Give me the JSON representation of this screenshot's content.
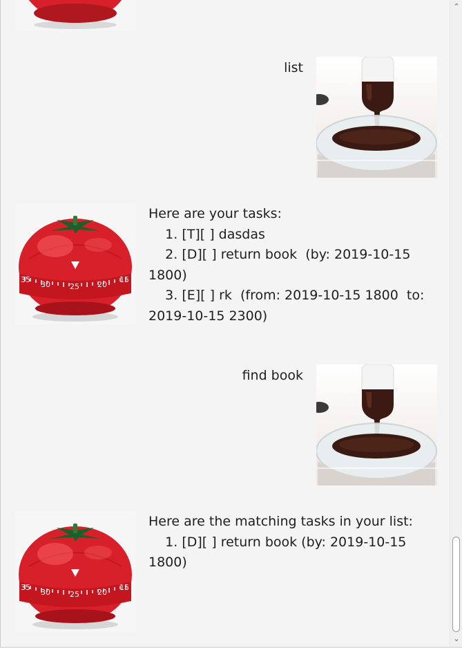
{
  "conversation": {
    "user_messages": [
      {
        "text": "list"
      },
      {
        "text": "find book"
      }
    ],
    "bot_messages": [
      {
        "lines": [
          "Here are your tasks:",
          "    1. [T][ ] dasdas",
          "    2. [D][ ] return book  (by: 2019-10-15",
          "1800)",
          "    3. [E][ ] rk  (from: 2019-10-15 1800  to:",
          "2019-10-15 2300)"
        ]
      },
      {
        "lines": [
          "Here are the matching tasks in your list:",
          "    1. [D][ ] return book (by: 2019-10-15",
          "1800)"
        ]
      }
    ],
    "timer_dial_labels": [
      "35",
      "30",
      "25",
      "20",
      "15"
    ]
  },
  "scrollbar": {
    "up_arrow": "⌃",
    "down_arrow": "⌄"
  },
  "colors": {
    "window_background": "#f4f4f4",
    "tomato_red": "#d8202a",
    "chocolate": "#3a1a12"
  }
}
